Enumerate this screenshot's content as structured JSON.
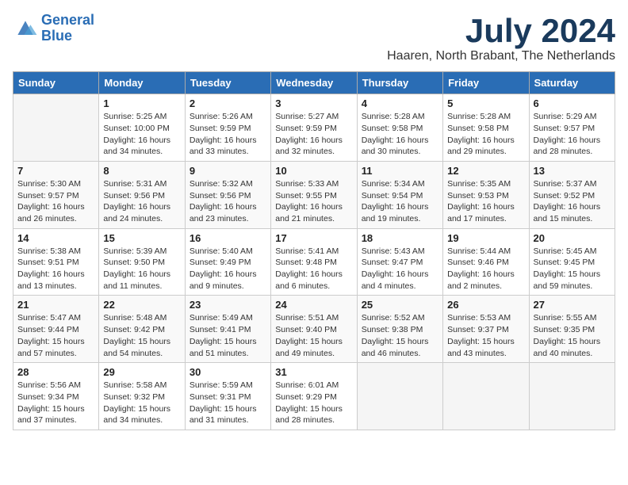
{
  "logo": {
    "line1": "General",
    "line2": "Blue"
  },
  "title": {
    "month": "July 2024",
    "location": "Haaren, North Brabant, The Netherlands"
  },
  "headers": [
    "Sunday",
    "Monday",
    "Tuesday",
    "Wednesday",
    "Thursday",
    "Friday",
    "Saturday"
  ],
  "weeks": [
    [
      {
        "day": "",
        "sunrise": "",
        "sunset": "",
        "daylight": ""
      },
      {
        "day": "1",
        "sunrise": "Sunrise: 5:25 AM",
        "sunset": "Sunset: 10:00 PM",
        "daylight": "Daylight: 16 hours and 34 minutes."
      },
      {
        "day": "2",
        "sunrise": "Sunrise: 5:26 AM",
        "sunset": "Sunset: 9:59 PM",
        "daylight": "Daylight: 16 hours and 33 minutes."
      },
      {
        "day": "3",
        "sunrise": "Sunrise: 5:27 AM",
        "sunset": "Sunset: 9:59 PM",
        "daylight": "Daylight: 16 hours and 32 minutes."
      },
      {
        "day": "4",
        "sunrise": "Sunrise: 5:28 AM",
        "sunset": "Sunset: 9:58 PM",
        "daylight": "Daylight: 16 hours and 30 minutes."
      },
      {
        "day": "5",
        "sunrise": "Sunrise: 5:28 AM",
        "sunset": "Sunset: 9:58 PM",
        "daylight": "Daylight: 16 hours and 29 minutes."
      },
      {
        "day": "6",
        "sunrise": "Sunrise: 5:29 AM",
        "sunset": "Sunset: 9:57 PM",
        "daylight": "Daylight: 16 hours and 28 minutes."
      }
    ],
    [
      {
        "day": "7",
        "sunrise": "Sunrise: 5:30 AM",
        "sunset": "Sunset: 9:57 PM",
        "daylight": "Daylight: 16 hours and 26 minutes."
      },
      {
        "day": "8",
        "sunrise": "Sunrise: 5:31 AM",
        "sunset": "Sunset: 9:56 PM",
        "daylight": "Daylight: 16 hours and 24 minutes."
      },
      {
        "day": "9",
        "sunrise": "Sunrise: 5:32 AM",
        "sunset": "Sunset: 9:56 PM",
        "daylight": "Daylight: 16 hours and 23 minutes."
      },
      {
        "day": "10",
        "sunrise": "Sunrise: 5:33 AM",
        "sunset": "Sunset: 9:55 PM",
        "daylight": "Daylight: 16 hours and 21 minutes."
      },
      {
        "day": "11",
        "sunrise": "Sunrise: 5:34 AM",
        "sunset": "Sunset: 9:54 PM",
        "daylight": "Daylight: 16 hours and 19 minutes."
      },
      {
        "day": "12",
        "sunrise": "Sunrise: 5:35 AM",
        "sunset": "Sunset: 9:53 PM",
        "daylight": "Daylight: 16 hours and 17 minutes."
      },
      {
        "day": "13",
        "sunrise": "Sunrise: 5:37 AM",
        "sunset": "Sunset: 9:52 PM",
        "daylight": "Daylight: 16 hours and 15 minutes."
      }
    ],
    [
      {
        "day": "14",
        "sunrise": "Sunrise: 5:38 AM",
        "sunset": "Sunset: 9:51 PM",
        "daylight": "Daylight: 16 hours and 13 minutes."
      },
      {
        "day": "15",
        "sunrise": "Sunrise: 5:39 AM",
        "sunset": "Sunset: 9:50 PM",
        "daylight": "Daylight: 16 hours and 11 minutes."
      },
      {
        "day": "16",
        "sunrise": "Sunrise: 5:40 AM",
        "sunset": "Sunset: 9:49 PM",
        "daylight": "Daylight: 16 hours and 9 minutes."
      },
      {
        "day": "17",
        "sunrise": "Sunrise: 5:41 AM",
        "sunset": "Sunset: 9:48 PM",
        "daylight": "Daylight: 16 hours and 6 minutes."
      },
      {
        "day": "18",
        "sunrise": "Sunrise: 5:43 AM",
        "sunset": "Sunset: 9:47 PM",
        "daylight": "Daylight: 16 hours and 4 minutes."
      },
      {
        "day": "19",
        "sunrise": "Sunrise: 5:44 AM",
        "sunset": "Sunset: 9:46 PM",
        "daylight": "Daylight: 16 hours and 2 minutes."
      },
      {
        "day": "20",
        "sunrise": "Sunrise: 5:45 AM",
        "sunset": "Sunset: 9:45 PM",
        "daylight": "Daylight: 15 hours and 59 minutes."
      }
    ],
    [
      {
        "day": "21",
        "sunrise": "Sunrise: 5:47 AM",
        "sunset": "Sunset: 9:44 PM",
        "daylight": "Daylight: 15 hours and 57 minutes."
      },
      {
        "day": "22",
        "sunrise": "Sunrise: 5:48 AM",
        "sunset": "Sunset: 9:42 PM",
        "daylight": "Daylight: 15 hours and 54 minutes."
      },
      {
        "day": "23",
        "sunrise": "Sunrise: 5:49 AM",
        "sunset": "Sunset: 9:41 PM",
        "daylight": "Daylight: 15 hours and 51 minutes."
      },
      {
        "day": "24",
        "sunrise": "Sunrise: 5:51 AM",
        "sunset": "Sunset: 9:40 PM",
        "daylight": "Daylight: 15 hours and 49 minutes."
      },
      {
        "day": "25",
        "sunrise": "Sunrise: 5:52 AM",
        "sunset": "Sunset: 9:38 PM",
        "daylight": "Daylight: 15 hours and 46 minutes."
      },
      {
        "day": "26",
        "sunrise": "Sunrise: 5:53 AM",
        "sunset": "Sunset: 9:37 PM",
        "daylight": "Daylight: 15 hours and 43 minutes."
      },
      {
        "day": "27",
        "sunrise": "Sunrise: 5:55 AM",
        "sunset": "Sunset: 9:35 PM",
        "daylight": "Daylight: 15 hours and 40 minutes."
      }
    ],
    [
      {
        "day": "28",
        "sunrise": "Sunrise: 5:56 AM",
        "sunset": "Sunset: 9:34 PM",
        "daylight": "Daylight: 15 hours and 37 minutes."
      },
      {
        "day": "29",
        "sunrise": "Sunrise: 5:58 AM",
        "sunset": "Sunset: 9:32 PM",
        "daylight": "Daylight: 15 hours and 34 minutes."
      },
      {
        "day": "30",
        "sunrise": "Sunrise: 5:59 AM",
        "sunset": "Sunset: 9:31 PM",
        "daylight": "Daylight: 15 hours and 31 minutes."
      },
      {
        "day": "31",
        "sunrise": "Sunrise: 6:01 AM",
        "sunset": "Sunset: 9:29 PM",
        "daylight": "Daylight: 15 hours and 28 minutes."
      },
      {
        "day": "",
        "sunrise": "",
        "sunset": "",
        "daylight": ""
      },
      {
        "day": "",
        "sunrise": "",
        "sunset": "",
        "daylight": ""
      },
      {
        "day": "",
        "sunrise": "",
        "sunset": "",
        "daylight": ""
      }
    ]
  ]
}
